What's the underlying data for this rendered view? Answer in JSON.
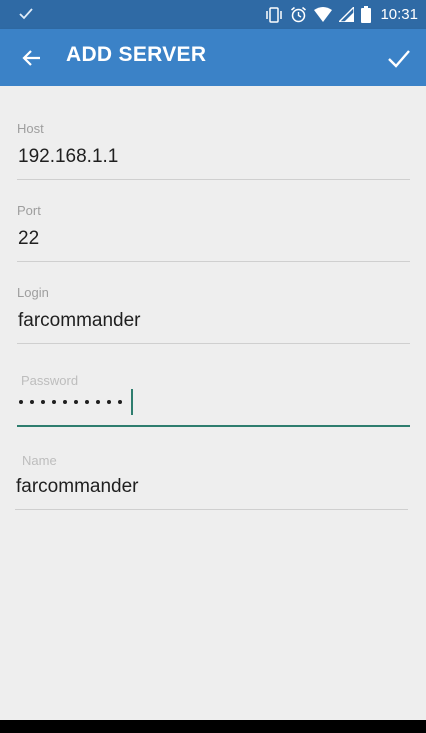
{
  "status_bar": {
    "time": "10:31",
    "left_icon": "check-icon",
    "icons": [
      "vibrate-icon",
      "alarm-icon",
      "wifi-icon",
      "signal-icon",
      "battery-icon"
    ]
  },
  "app_bar": {
    "title": "ADD SERVER",
    "back_icon": "arrow-left-icon",
    "confirm_icon": "check-icon",
    "color": "#3b82c7",
    "status_color": "#2f6aa5"
  },
  "form": {
    "host": {
      "label": "Host",
      "value": "192.168.1.1"
    },
    "port": {
      "label": "Port",
      "value": "22"
    },
    "login": {
      "label": "Login",
      "value": "farcommander"
    },
    "password": {
      "label": "Password",
      "masked_length": 10
    },
    "name": {
      "label": "Name",
      "value": "farcommander"
    }
  },
  "accent_color": "#2e7d6e"
}
